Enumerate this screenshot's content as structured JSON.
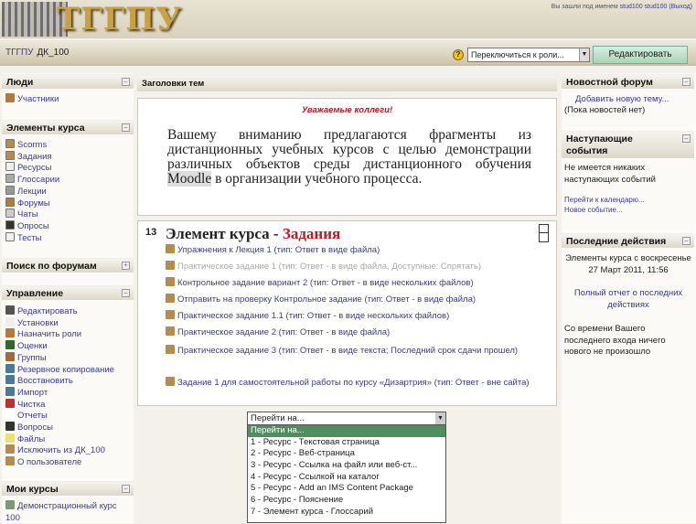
{
  "header": {
    "logo_text": "ТГГПУ",
    "login_prefix": "Вы зашли под именем",
    "user": "stud100 stud100",
    "logout": "(Выход)"
  },
  "nav": {
    "breadcrumb": [
      "ТГГПУ",
      "ДК_100"
    ],
    "role_select": "Переключиться к роли...",
    "edit_button": "Редактировать"
  },
  "left": {
    "people": {
      "title": "Люди",
      "items": [
        "Участники"
      ]
    },
    "activities": {
      "title": "Элементы курса",
      "items": [
        "Scorms",
        "Задания",
        "Ресурсы",
        "Глоссарии",
        "Лекции",
        "Форумы",
        "Чаты",
        "Опросы",
        "Тесты"
      ]
    },
    "search": {
      "title": "Поиск по форумам"
    },
    "admin": {
      "title": "Управление",
      "items": [
        "Редактировать",
        "Установки",
        "Назначить роли",
        "Оценки",
        "Группы",
        "Резервное копирование",
        "Восстановить",
        "Импорт",
        "Чистка",
        "Отчеты",
        "Вопросы",
        "Файлы",
        "Исключить из ДК_100",
        "О пользователе"
      ]
    },
    "mycourses": {
      "title": "Мои курсы",
      "items": [
        "Демонстрационный курс 100"
      ]
    }
  },
  "center": {
    "title": "Заголовки тем",
    "welcome": "Уважаемые коллеги!",
    "intro_a": "Вашему вниманию предлагаются фрагменты из дистанционных учебных курсов с целью демонстрации различных объектов среды дистанционного обучения ",
    "intro_hl": "Moodle",
    "intro_b": " в организации учебного процесса.",
    "section": {
      "number": "13",
      "title_a": "Элемент курса - ",
      "title_b": "Задания",
      "items": [
        "Упражнения к Лекция 1 (тип: Ответ в виде файла)",
        "Практическое задание 1 (тип: Ответ - в виде файла, Доступные: Спрятать)",
        "Контрольное задание вариант 2 (тип: Ответ - в виде нескольких файлов)",
        "Отправить на проверку Контрольное задание (тип: Ответ - в виде файла)",
        "Практическое задание 1.1 (тип: Ответ - в виде нескольких файлов)",
        "Практическое задание 2 (тип: Ответ - в виде файла)",
        "Практическое задание 3 (тип: Ответ - в виде текста; Последний срок сдачи прошел)",
        "Задание 1 для самостоятельной работы по курсу «Дизартрия» (тип: Ответ - вне сайта)"
      ]
    },
    "jump": {
      "value": "Перейти на...",
      "options": [
        "Перейти на...",
        "1 - Ресурс - Текстовая страница",
        "2 - Ресурс - Веб-страница",
        "3 - Ресурс - Ссылка на файл или веб-ст...",
        "4 - Ресурс - Ссылкой на каталог",
        "5 - Ресурс - Add an IMS Content Package",
        "6 - Ресурс - Пояснение",
        "7 - Элемент курса - Глоссарий"
      ]
    }
  },
  "right": {
    "news": {
      "title": "Новостной форум",
      "add": "Добавить новую тему...",
      "none": "(Пока новостей нет)"
    },
    "events": {
      "title": "Наступающие события",
      "none": "Не имеется никаких наступающих событий",
      "calendar": "Перейти к календарю...",
      "new_event": "Новое событие..."
    },
    "recent": {
      "title": "Последние действия",
      "since": "Элементы курса с воскресенье 27 Март 2011, 11:56",
      "full_report": "Полный отчет о последних действиях",
      "nothing": "Со времени Вашего последнего входа ничего нового не произошло"
    }
  }
}
